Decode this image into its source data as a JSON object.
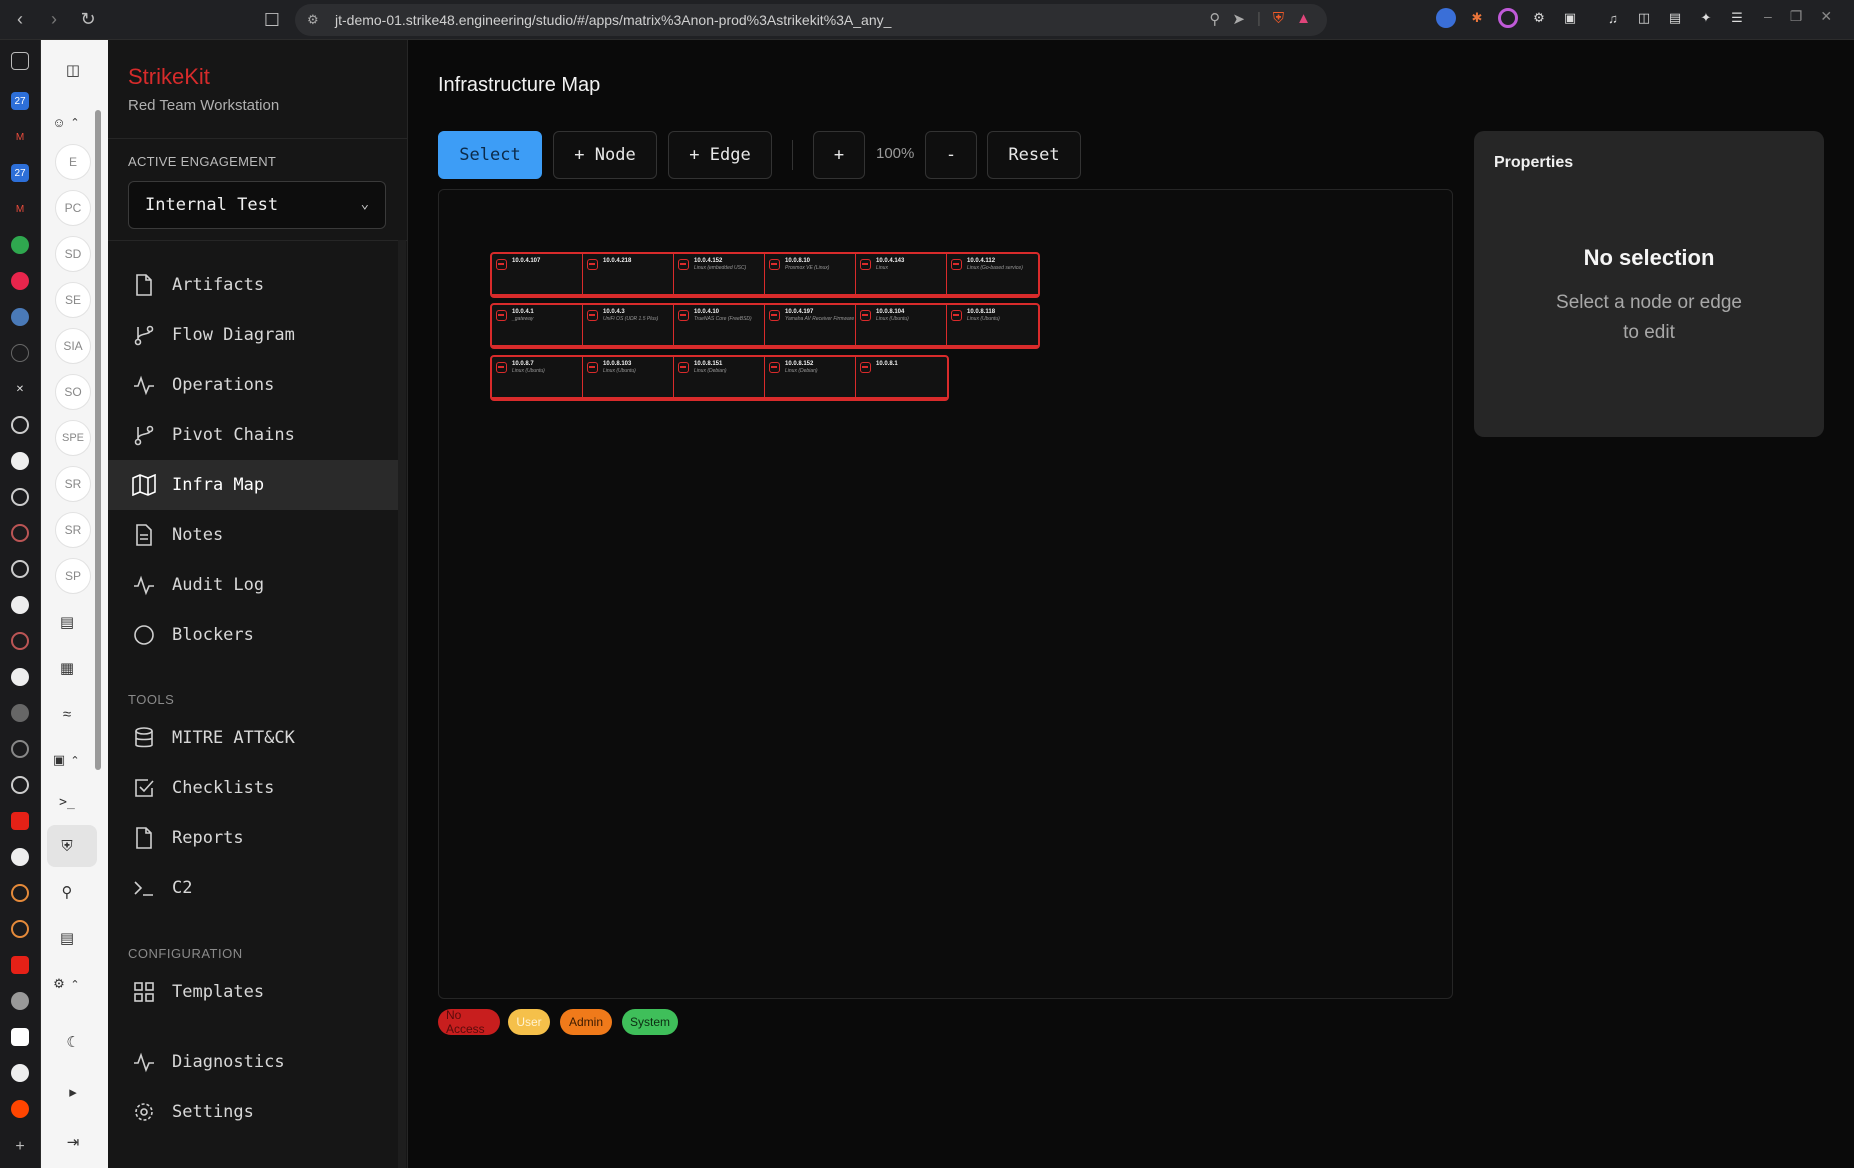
{
  "browser": {
    "url": "jt-demo-01.strike48.engineering/studio/#/apps/matrix%3Anon-prod%3Astrikekit%3A_any_"
  },
  "rail": {
    "items": [
      "E",
      "PC",
      "SD",
      "SE",
      "SIA",
      "SO",
      "SPE",
      "SR",
      "SR",
      "SP"
    ]
  },
  "brand": {
    "title": "StrikeKit",
    "subtitle": "Red Team Workstation"
  },
  "engagement": {
    "label": "ACTIVE ENGAGEMENT",
    "selected": "Internal Test"
  },
  "nav": {
    "items": [
      {
        "label": "Artifacts",
        "icon": "file-icon"
      },
      {
        "label": "Flow Diagram",
        "icon": "branch-icon"
      },
      {
        "label": "Operations",
        "icon": "activity-icon"
      },
      {
        "label": "Pivot Chains",
        "icon": "branch-icon"
      },
      {
        "label": "Infra Map",
        "icon": "map-icon",
        "active": true
      },
      {
        "label": "Notes",
        "icon": "notes-icon"
      },
      {
        "label": "Audit Log",
        "icon": "activity-icon"
      },
      {
        "label": "Blockers",
        "icon": "circle-icon"
      }
    ],
    "tools_label": "TOOLS",
    "tools": [
      {
        "label": "MITRE ATT&CK",
        "icon": "database-icon"
      },
      {
        "label": "Checklists",
        "icon": "checkbox-icon"
      },
      {
        "label": "Reports",
        "icon": "file-icon"
      },
      {
        "label": "C2",
        "icon": "terminal-icon"
      }
    ],
    "config_label": "CONFIGURATION",
    "config": [
      {
        "label": "Templates",
        "icon": "grid-icon"
      },
      {
        "label": "Diagnostics",
        "icon": "activity-icon"
      },
      {
        "label": "Settings",
        "icon": "gear-icon"
      }
    ]
  },
  "page": {
    "title": "Infrastructure Map"
  },
  "toolbar": {
    "select": "Select",
    "node": "+ Node",
    "edge": "+ Edge",
    "zoom_in": "+",
    "zoom_level": "100%",
    "zoom_out": "-",
    "reset": "Reset"
  },
  "hosts": [
    [
      {
        "ip": "10.0.4.107",
        "os": ""
      },
      {
        "ip": "10.0.4.218",
        "os": ""
      },
      {
        "ip": "10.0.4.152",
        "os": "Linux (embedded USC)"
      },
      {
        "ip": "10.0.8.10",
        "os": "Proxmox VE (Linux)"
      },
      {
        "ip": "10.0.4.143",
        "os": "Linux"
      },
      {
        "ip": "10.0.4.112",
        "os": "Linux (Go-based service)"
      }
    ],
    [
      {
        "ip": "10.0.4.1",
        "os": "_gateway"
      },
      {
        "ip": "10.0.4.3",
        "os": "UniFi OS (UDR 1.5 Plus)"
      },
      {
        "ip": "10.0.4.10",
        "os": "TrueNAS Core (FreeBSD)"
      },
      {
        "ip": "10.0.4.197",
        "os": "Yamaha AV Receiver Firmware"
      },
      {
        "ip": "10.0.8.104",
        "os": "Linux (Ubuntu)"
      },
      {
        "ip": "10.0.8.118",
        "os": "Linux (Ubuntu)"
      }
    ],
    [
      {
        "ip": "10.0.8.7",
        "os": "Linux (Ubuntu)"
      },
      {
        "ip": "10.0.8.103",
        "os": "Linux (Ubuntu)"
      },
      {
        "ip": "10.0.8.151",
        "os": "Linux (Debian)"
      },
      {
        "ip": "10.0.8.152",
        "os": "Linux (Debian)"
      },
      {
        "ip": "10.0.8.1",
        "os": ""
      }
    ]
  ],
  "legend": [
    {
      "label": "No Access",
      "bg": "#c81e1e",
      "fg": "#5a0b0b"
    },
    {
      "label": "User",
      "bg": "#f5c04a",
      "fg": "#fff3d0"
    },
    {
      "label": "Admin",
      "bg": "#f07a1a",
      "fg": "#3a1a00"
    },
    {
      "label": "System",
      "bg": "#3fbf5a",
      "fg": "#0c2c12"
    }
  ],
  "properties": {
    "title": "Properties",
    "empty_title": "No selection",
    "empty_sub": "Select a node or edge to edit"
  }
}
